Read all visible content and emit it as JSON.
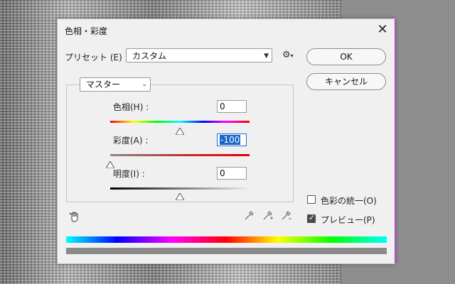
{
  "dialog": {
    "title": "色相・彩度",
    "close_glyph": "✕"
  },
  "preset": {
    "label": "プリセット (E) :",
    "value": "カスタム"
  },
  "buttons": {
    "ok": "OK",
    "cancel": "キャンセル"
  },
  "channel": {
    "value": "マスター"
  },
  "sliders": [
    {
      "label": "色相(H) :",
      "value": "0",
      "position_fraction": 0.5
    },
    {
      "label": "彩度(A) :",
      "value": "-100",
      "position_fraction": 0.0
    },
    {
      "label": "明度(I) :",
      "value": "0",
      "position_fraction": 0.5
    }
  ],
  "options": {
    "colorize_label": "色彩の統一(O)",
    "colorize_checked": false,
    "preview_label": "プレビュー(P)",
    "preview_checked": true
  },
  "icons": {
    "gear": "gear-icon",
    "hand": "targeted-adjustment-hand-icon",
    "dropper": "eyedropper-icon",
    "dropper_add": "eyedropper-plus-icon",
    "dropper_sub": "eyedropper-minus-icon",
    "chevron": "chevron-down-icon"
  },
  "colors": {
    "accent_focus": "#1a66c9",
    "dialog_edge": "#b04ec2"
  }
}
